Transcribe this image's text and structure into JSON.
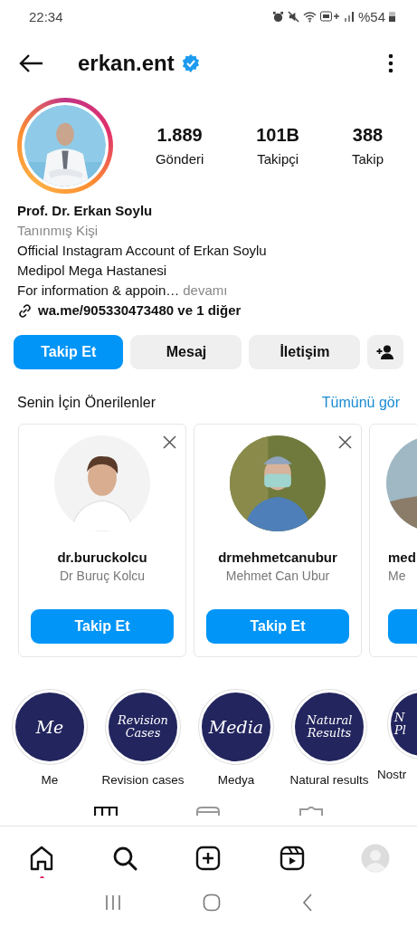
{
  "status_bar": {
    "time": "22:34",
    "battery": "%54"
  },
  "header": {
    "username": "erkan.ent",
    "verified": true
  },
  "profile": {
    "stats": [
      {
        "value": "1.889",
        "label": "Gönderi"
      },
      {
        "value": "101B",
        "label": "Takipçi"
      },
      {
        "value": "388",
        "label": "Takip"
      }
    ],
    "name": "Prof. Dr. Erkan Soylu",
    "category": "Tanınmış Kişi",
    "bio": [
      "Official Instagram Account of Erkan Soylu",
      "Medipol Mega Hastanesi"
    ],
    "bio_truncated": "For information & appoin…",
    "more": "devamı",
    "link": "wa.me/905330473480 ve 1 diğer"
  },
  "actions": [
    {
      "label": "Takip Et",
      "kind": "primary"
    },
    {
      "label": "Mesaj",
      "kind": "secondary"
    },
    {
      "label": "İletişim",
      "kind": "secondary"
    },
    {
      "kind": "add-person"
    }
  ],
  "suggestions": {
    "title": "Senin İçin Önerilenler",
    "see_all": "Tümünü gör",
    "cards": [
      {
        "username": "dr.buruckolcu",
        "name": "Dr Buruç Kolcu",
        "button": "Takip Et",
        "kind": "picture"
      },
      {
        "username": "drmehmetcanubur",
        "name": "Mehmet Can Ubur",
        "button": "Takip Et",
        "kind": "picture"
      },
      {
        "username": "med",
        "name": "Me",
        "kind": "picture"
      }
    ]
  },
  "highlights": [
    {
      "cover": [
        "Me"
      ],
      "label": "Me"
    },
    {
      "cover": [
        "Revision",
        "Cases"
      ],
      "label": "Revision cases"
    },
    {
      "cover": [
        "Media"
      ],
      "label": "Medya"
    },
    {
      "cover": [
        "Natural",
        "Results"
      ],
      "label": "Natural results"
    },
    {
      "cover": [
        "N",
        "Pl"
      ],
      "label": "Nostr"
    }
  ],
  "bottom_nav": [
    {
      "kind": "home",
      "selected": false,
      "notification": true
    },
    {
      "kind": "search",
      "selected": false
    },
    {
      "kind": "create",
      "selected": false
    },
    {
      "kind": "reels",
      "selected": false
    },
    {
      "kind": "profile",
      "selected": false
    }
  ]
}
